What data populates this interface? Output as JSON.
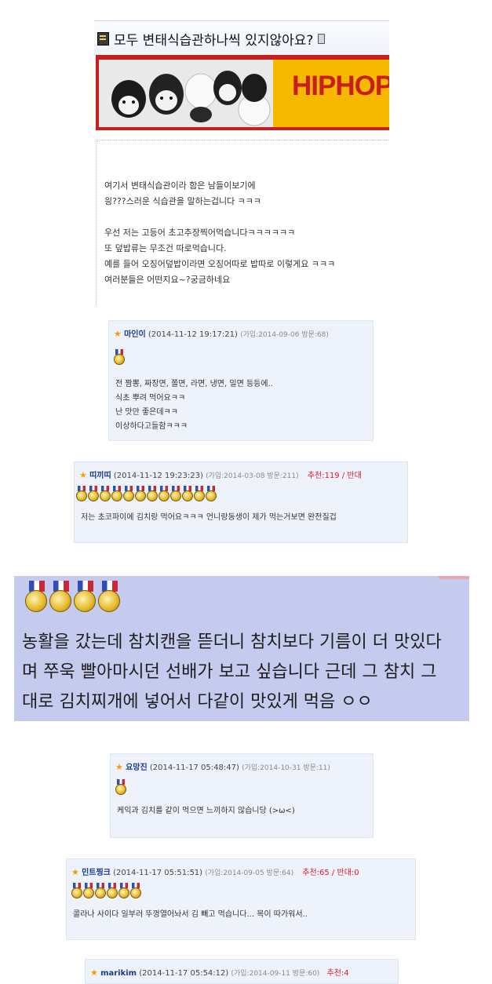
{
  "post": {
    "title": "모두 변태식습관하나씩 있지않아요?",
    "banner_text": "HIPHOP",
    "body_lines": [
      "여기서 변태식습관이라 함은 남들이보기에",
      "읭???스러운 식습관을 말하는겁니다 ㅋㅋㅋ",
      "",
      "우선 저는 고등어 초고추장찍어먹습니다ㅋㅋㅋㅋㅋㅋ",
      "또 덮밥류는 무조건 따로먹습니다.",
      "예를 들어 오징어덮밥이라면 오징어따로 밥따로 이렇게요 ㅋㅋㅋ",
      " 여러분들은 어떤지요~?궁금하네요"
    ]
  },
  "comments": [
    {
      "nick": "마인이",
      "datetime": "(2014-11-12 19:17:21)",
      "meta": "(가입:2014-09-06 방문:68)",
      "recommend": "",
      "medals": 1,
      "lines": [
        "전 짬뽕, 짜장면, 쫄면, 라면, 냉면, 밀면 등등에..",
        "식초 뿌려 먹어요ㅋㅋ",
        "난 맛만 좋은데ㅋㅋ",
        "이상하다고들함ㅋㅋㅋ"
      ]
    },
    {
      "nick": "띠끼띠",
      "datetime": "(2014-11-12 19:23:23)",
      "meta": "(가입:2014-03-08 방문:211)",
      "recommend": "추천:119 / 반대",
      "medals": 12,
      "lines": [
        "저는 초코파이에 김치랑 먹어요ㅋㅋㅋ 언니랑동생이 제가 먹는거보면 완전질겁"
      ]
    },
    {
      "nick": "요망진",
      "datetime": "(2014-11-17 05:48:47)",
      "meta": "(가입:2014-10-31 방문:11)",
      "recommend": "",
      "medals": 1,
      "lines": [
        "케익과 김치를 같이 먹으면 느끼하지 않습니당 (>ω<)"
      ]
    },
    {
      "nick": "민트찡크",
      "datetime": "(2014-11-17 05:51:51)",
      "meta": "(가입:2014-09-05 방문:64)",
      "recommend": "추천:65 / 반대:0",
      "medals": 6,
      "lines": [
        "콜라나 사이다 일부러 뚜껑열어놔서 김 빼고 먹습니다... 목이 따가워서.."
      ]
    },
    {
      "nick": "marikim",
      "datetime": "(2014-11-17 05:54:12)",
      "meta": "(가입:2014-09-11 방문:60)",
      "recommend": "추천:4",
      "medals": 0,
      "lines": []
    }
  ],
  "zoomed_comment": {
    "medals": 4,
    "lines": [
      "농활을 갔는데 참치캔을 뜯더니 참치보다 기름이 더 맛있다",
      "며 쭈욱 빨아마시던 선배가 보고 싶습니다 근데 그 참치 그",
      "대로 김치찌개에 넣어서 다같이 맛있게 먹음 ㅇㅇ"
    ]
  },
  "colors": {
    "nick": "#1a3a8c",
    "recommend": "#e0192a",
    "comment_bg": "#eef3fb",
    "zoom_bg": "#c5cbee"
  }
}
